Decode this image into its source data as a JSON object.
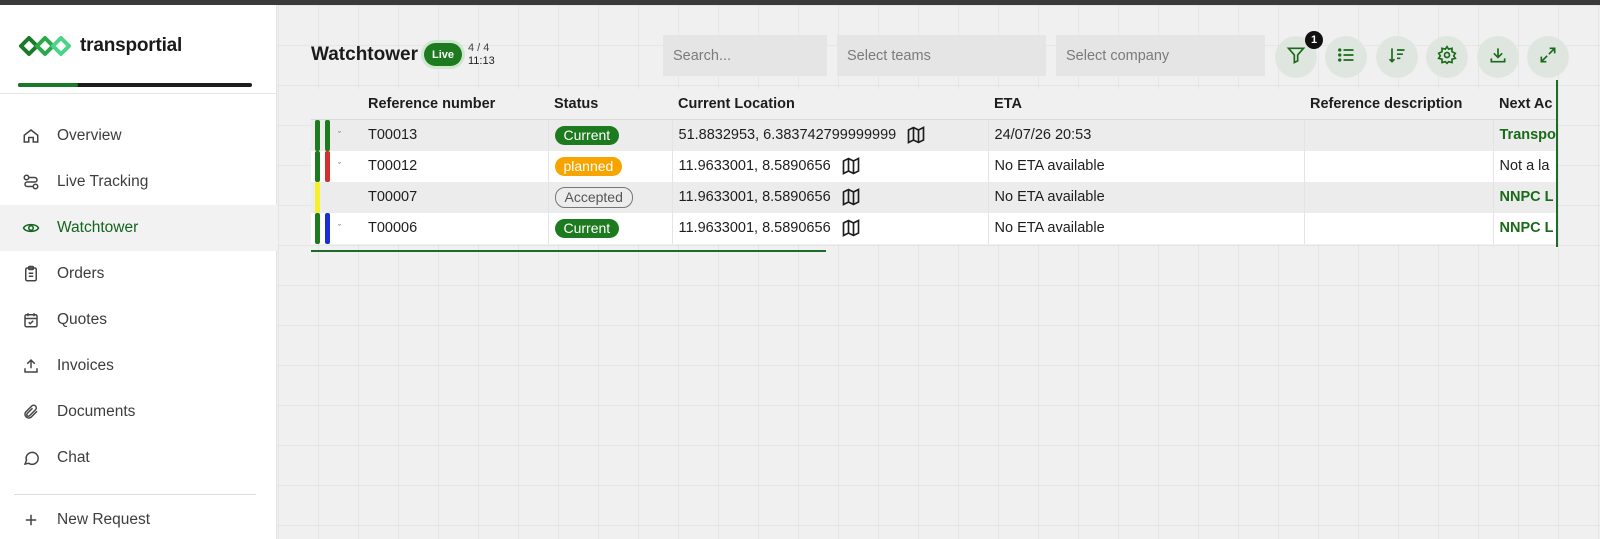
{
  "app": {
    "name": "transportial"
  },
  "sidebar": {
    "items": [
      {
        "label": "Overview",
        "icon": "home-icon",
        "active": false
      },
      {
        "label": "Live Tracking",
        "icon": "route-icon",
        "active": false
      },
      {
        "label": "Watchtower",
        "icon": "eye-icon",
        "active": true
      },
      {
        "label": "Orders",
        "icon": "clipboard-icon",
        "active": false
      },
      {
        "label": "Quotes",
        "icon": "calendar-check-icon",
        "active": false
      },
      {
        "label": "Invoices",
        "icon": "upload-icon",
        "active": false
      },
      {
        "label": "Documents",
        "icon": "paperclip-icon",
        "active": false
      },
      {
        "label": "Chat",
        "icon": "chat-icon",
        "active": false
      }
    ],
    "new_request": "New Request"
  },
  "header": {
    "title": "Watchtower",
    "live": "Live",
    "count": "4 / 4",
    "time": "11:13",
    "search_placeholder": "Search...",
    "teams_placeholder": "Select teams",
    "company_placeholder": "Select company",
    "filter_count": "1"
  },
  "toolbar": {
    "buttons": [
      "filter-icon",
      "list-icon",
      "sort-icon",
      "settings-icon",
      "download-icon",
      "expand-icon"
    ]
  },
  "table": {
    "columns": [
      "Reference number",
      "Status",
      "Current Location",
      "ETA",
      "Reference description",
      "Next Ac"
    ],
    "rows": [
      {
        "flags": [
          "#1e7a1e",
          "#1e7a1e"
        ],
        "expandable": true,
        "reference": "T00013",
        "status": "Current",
        "status_type": "current",
        "location": "51.8832953, 6.383742799999999",
        "eta": "24/07/26 20:53",
        "description": "",
        "next_action": "Transpo",
        "next_bold": true
      },
      {
        "flags": [
          "#1e7a1e",
          "#d32f2f"
        ],
        "expandable": true,
        "reference": "T00012",
        "status": "planned",
        "status_type": "planned",
        "location": "11.9633001, 8.5890656",
        "eta": "No ETA available",
        "description": "",
        "next_action": "Not a la",
        "next_bold": false
      },
      {
        "flags": [
          "#f7ef2a"
        ],
        "expandable": false,
        "reference": "T00007",
        "status": "Accepted",
        "status_type": "accepted",
        "location": "11.9633001, 8.5890656",
        "eta": "No ETA available",
        "description": "",
        "next_action": "NNPC L",
        "next_bold": true
      },
      {
        "flags": [
          "#1e7a1e",
          "#1a2fd6"
        ],
        "expandable": true,
        "reference": "T00006",
        "status": "Current",
        "status_type": "current",
        "location": "11.9633001, 8.5890656",
        "eta": "No ETA available",
        "description": "",
        "next_action": "NNPC L",
        "next_bold": true
      }
    ]
  }
}
